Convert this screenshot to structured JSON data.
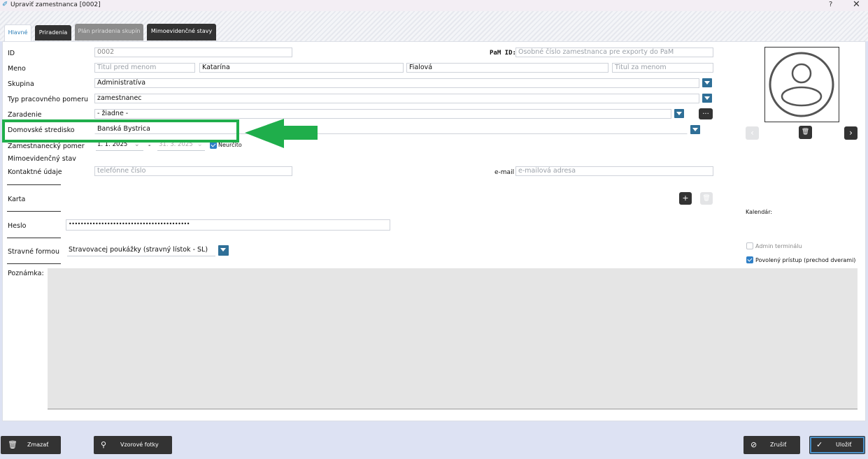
{
  "window": {
    "title": "Upraviť zamestnanca [0002]",
    "help": "?",
    "close": "✕"
  },
  "tabs": [
    {
      "label": "Hlavné"
    },
    {
      "label": "Priradenia"
    },
    {
      "label": "Plán priradenia skupín"
    },
    {
      "label": "Mimoevidenčné stavy"
    }
  ],
  "form": {
    "id": {
      "label": "ID",
      "value": "0002"
    },
    "pam": {
      "label": "PaM ID:",
      "placeholder": "Osobné číslo zamestnanca pre exporty do PaM"
    },
    "meno": {
      "label": "Meno",
      "titul_pred": "Titul pred menom",
      "first": "Katarína",
      "last": "Fialová",
      "titul_za": "Titul za menom"
    },
    "skupina": {
      "label": "Skupina",
      "value": "Administratíva"
    },
    "typ": {
      "label": "Typ pracovného pomeru",
      "value": "zamestnanec"
    },
    "zaradenie": {
      "label": "Zaradenie",
      "value": "- žiadne -",
      "more": "..."
    },
    "stredisko": {
      "label": "Domovské stredisko",
      "value": "Banská Bystrica"
    },
    "pomer": {
      "label": "Zamestnanecký pomer",
      "from": "1. 1. 2025",
      "dash": "-",
      "to": "31. 3. 2025",
      "neurcito": "Neurčito"
    },
    "mimo": {
      "label": "Mimoevidenčný stav"
    },
    "kontakt": {
      "label": "Kontaktné údaje",
      "phone_placeholder": "telefónne číslo",
      "email_label": "e-mail",
      "email_placeholder": "e-mailová adresa"
    },
    "karta": {
      "label": "Karta",
      "add": "+",
      "del": "🗑"
    },
    "heslo": {
      "label": "Heslo",
      "value": "•••••••••••••••••••••••••••••••••••••••••"
    },
    "stravne": {
      "label": "Stravné formou",
      "value": "Stravovacej poukážky (stravný lístok - SL)"
    },
    "poznamka": {
      "label": "Poznámka:"
    }
  },
  "side": {
    "kalendar": "Kalendár:",
    "admin_terminal": {
      "label": "Admin terminálu",
      "checked": false
    },
    "povoleny": {
      "label": "Povolený prístup (prechod dverami)",
      "checked": true
    },
    "prev": "‹",
    "next": "›",
    "delete_photo": "🗑"
  },
  "footer": {
    "delete": "Zmazať",
    "photos": "Vzorové fotky",
    "cancel": "Zrušiť",
    "save": "Uložiť"
  },
  "colors": {
    "accent": "#2f6f97",
    "highlight": "#1fae4b",
    "dark_button": "#333333"
  }
}
